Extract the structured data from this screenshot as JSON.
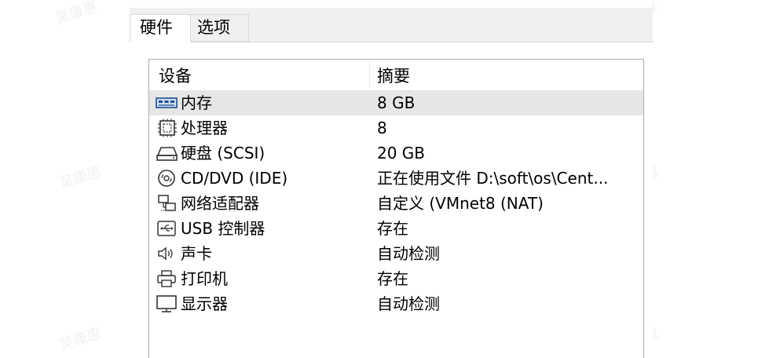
{
  "tabs": [
    {
      "label": "硬件",
      "active": true
    },
    {
      "label": "选项",
      "active": false
    }
  ],
  "table": {
    "headers": {
      "device": "设备",
      "summary": "摘要"
    },
    "rows": [
      {
        "icon": "memory-icon",
        "device": "内存",
        "summary": "8 GB",
        "selected": true
      },
      {
        "icon": "processor-icon",
        "device": "处理器",
        "summary": "8",
        "selected": false
      },
      {
        "icon": "hard-disk-icon",
        "device": "硬盘 (SCSI)",
        "summary": "20 GB",
        "selected": false
      },
      {
        "icon": "cd-dvd-icon",
        "device": "CD/DVD (IDE)",
        "summary": "正在使用文件 D:\\soft\\os\\Cent...",
        "selected": false
      },
      {
        "icon": "network-adapter-icon",
        "device": "网络适配器",
        "summary": "自定义 (VMnet8 (NAT)",
        "selected": false
      },
      {
        "icon": "usb-controller-icon",
        "device": "USB 控制器",
        "summary": "存在",
        "selected": false
      },
      {
        "icon": "sound-card-icon",
        "device": "声卡",
        "summary": "自动检测",
        "selected": false
      },
      {
        "icon": "printer-icon",
        "device": "打印机",
        "summary": "存在",
        "selected": false
      },
      {
        "icon": "display-icon",
        "device": "显示器",
        "summary": "自动检测",
        "selected": false
      }
    ]
  },
  "watermark": "吴康惠",
  "colors": {
    "selected_row": "#e6e6e6",
    "tabbar": "#f0f0f0",
    "border": "#adadad"
  }
}
